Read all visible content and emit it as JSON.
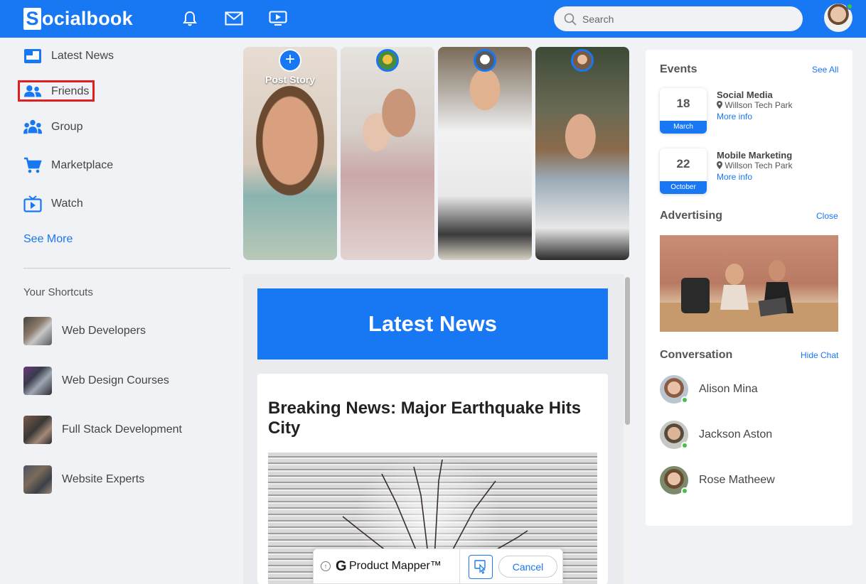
{
  "header": {
    "logo_letter": "S",
    "logo_text": "ocialbook",
    "search_placeholder": "Search"
  },
  "sidebar": {
    "items": [
      {
        "label": "Latest News",
        "icon": "newspaper-icon"
      },
      {
        "label": "Friends",
        "icon": "friends-icon"
      },
      {
        "label": "Group",
        "icon": "group-icon"
      },
      {
        "label": "Marketplace",
        "icon": "cart-icon"
      },
      {
        "label": "Watch",
        "icon": "tv-icon"
      }
    ],
    "see_more": "See More",
    "shortcuts_title": "Your Shortcuts",
    "shortcuts": [
      {
        "label": "Web Developers"
      },
      {
        "label": "Web Design Courses"
      },
      {
        "label": "Full Stack Development"
      },
      {
        "label": "Website Experts"
      }
    ]
  },
  "stories": {
    "post_label": "Post Story"
  },
  "feed": {
    "banner": "Latest News",
    "post_title": "Breaking News: Major Earthquake Hits City"
  },
  "product_mapper": {
    "g_letter": "G",
    "name": "Product Mapper™",
    "cancel": "Cancel"
  },
  "right": {
    "events_title": "Events",
    "see_all": "See All",
    "events": [
      {
        "day": "18",
        "month": "March",
        "name": "Social Media",
        "place": "Willson Tech Park",
        "more": "More info"
      },
      {
        "day": "22",
        "month": "October",
        "name": "Mobile Marketing",
        "place": "Willson Tech Park",
        "more": "More info"
      }
    ],
    "advertising_title": "Advertising",
    "close": "Close",
    "conversation_title": "Conversation",
    "hide_chat": "Hide Chat",
    "chats": [
      {
        "name": "Alison Mina"
      },
      {
        "name": "Jackson Aston"
      },
      {
        "name": "Rose Matheew"
      }
    ]
  },
  "colors": {
    "brand": "#1877f2",
    "online": "#41c341",
    "highlight": "#e02020"
  }
}
